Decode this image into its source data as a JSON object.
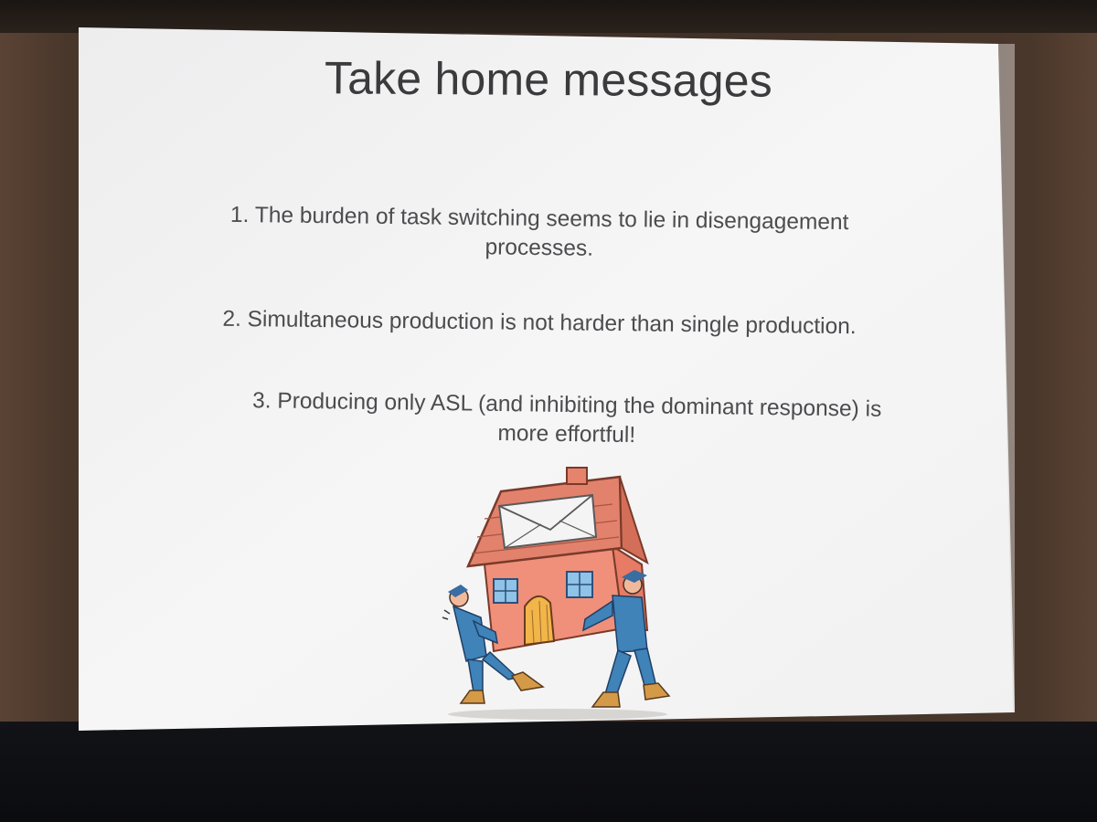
{
  "slide": {
    "title": "Take home messages",
    "points": [
      {
        "line1": "1. The burden of task switching seems to lie in disengagement",
        "line2": "processes."
      },
      {
        "line1": "2. Simultaneous production is not harder than single production."
      },
      {
        "line1": "3. Producing only ASL (and inhibiting the dominant response) is",
        "line2": "more effortful!"
      }
    ],
    "illustration": "two-movers-carrying-house-clipart"
  },
  "colors": {
    "slide_background": "#f3f3f3",
    "text": "#4c4c4f",
    "title": "#3b3b3d",
    "room": "#3d2e25",
    "house_wall": "#f0907a",
    "roof": "#e2826c",
    "movers_uniform": "#3f83b8"
  }
}
